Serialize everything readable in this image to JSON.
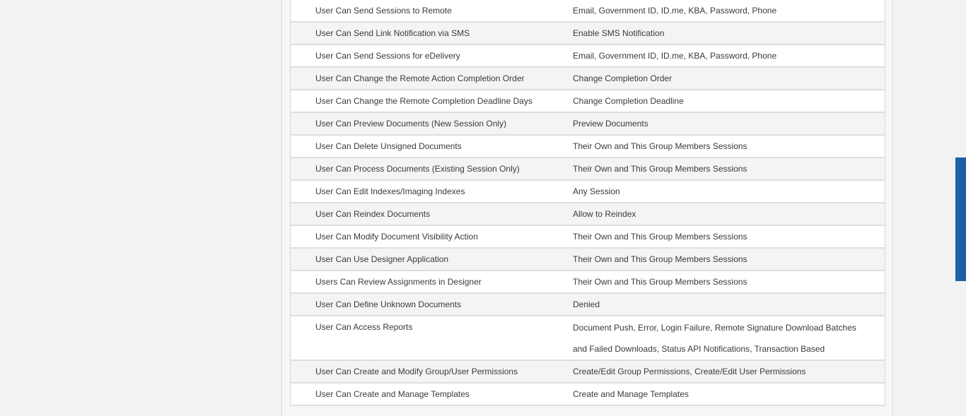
{
  "permissions": [
    {
      "label": "User Can Send Sessions to Remote",
      "value": "Email, Government ID, ID.me, KBA, Password, Phone"
    },
    {
      "label": "User Can Send Link Notification via SMS",
      "value": "Enable SMS Notification"
    },
    {
      "label": "User Can Send Sessions for eDelivery",
      "value": "Email, Government ID, ID.me, KBA, Password, Phone"
    },
    {
      "label": "User Can Change the Remote Action Completion Order",
      "value": "Change Completion Order"
    },
    {
      "label": "User Can Change the Remote Completion Deadline Days",
      "value": "Change Completion Deadline"
    },
    {
      "label": "User Can Preview Documents (New Session Only)",
      "value": "Preview Documents"
    },
    {
      "label": "User Can Delete Unsigned Documents",
      "value": "Their Own and This Group Members Sessions"
    },
    {
      "label": "User Can Process Documents (Existing Session Only)",
      "value": "Their Own and This Group Members Sessions"
    },
    {
      "label": "User Can Edit Indexes/Imaging Indexes",
      "value": "Any Session"
    },
    {
      "label": "User Can Reindex Documents",
      "value": "Allow to Reindex"
    },
    {
      "label": "User Can Modify Document Visibility Action",
      "value": "Their Own and This Group Members Sessions"
    },
    {
      "label": "User Can Use Designer Application",
      "value": "Their Own and This Group Members Sessions"
    },
    {
      "label": "Users Can Review Assignments in Designer",
      "value": "Their Own and This Group Members Sessions"
    },
    {
      "label": "User Can Define Unknown Documents",
      "value": "Denied"
    },
    {
      "label": "User Can Access Reports",
      "value": "Document Push, Error, Login Failure, Remote Signature Download Batches and Failed Downloads, Status API Notifications, Transaction Based"
    },
    {
      "label": "User Can Create and Modify Group/User Permissions",
      "value": "Create/Edit Group Permissions, Create/Edit User Permissions"
    },
    {
      "label": "User Can Create and Manage Templates",
      "value": "Create and Manage Templates"
    }
  ]
}
